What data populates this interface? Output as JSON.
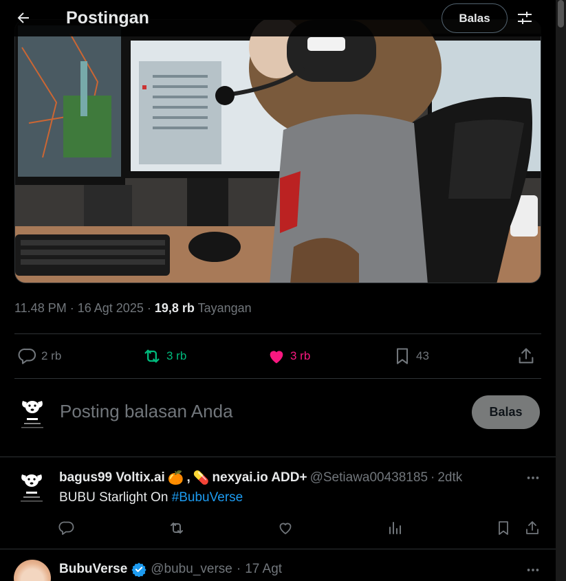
{
  "header": {
    "title": "Postingan",
    "reply_button": "Balas"
  },
  "post": {
    "time": "11.48 PM",
    "separator": "·",
    "date": "16 Agt 2025",
    "views_count": "19,8 rb",
    "views_label": "Tayangan",
    "stats": {
      "replies": "2 rb",
      "reposts": "3 rb",
      "likes": "3 rb",
      "bookmarks": "43"
    },
    "colors": {
      "repost": "#00ba7c",
      "like": "#f91880",
      "muted": "#71767b"
    }
  },
  "compose": {
    "placeholder": "Posting balasan Anda",
    "button": "Balas"
  },
  "replies": [
    {
      "name_part1": "bagus99 Voltix.ai",
      "emoji1": "🍊",
      "comma": ",",
      "emoji2": "💊",
      "name_part2": "nexyai.io ADD+",
      "handle": "@Setiawa00438185",
      "dot": "·",
      "time": "2dtk",
      "text": "BUBU Starlight On",
      "hashtag": "#BubuVerse"
    }
  ],
  "next_post": {
    "name": "BubuVerse",
    "handle": "@bubu_verse",
    "dot": "·",
    "date": "17 Agt",
    "verified_color": "#1d9bf0"
  }
}
